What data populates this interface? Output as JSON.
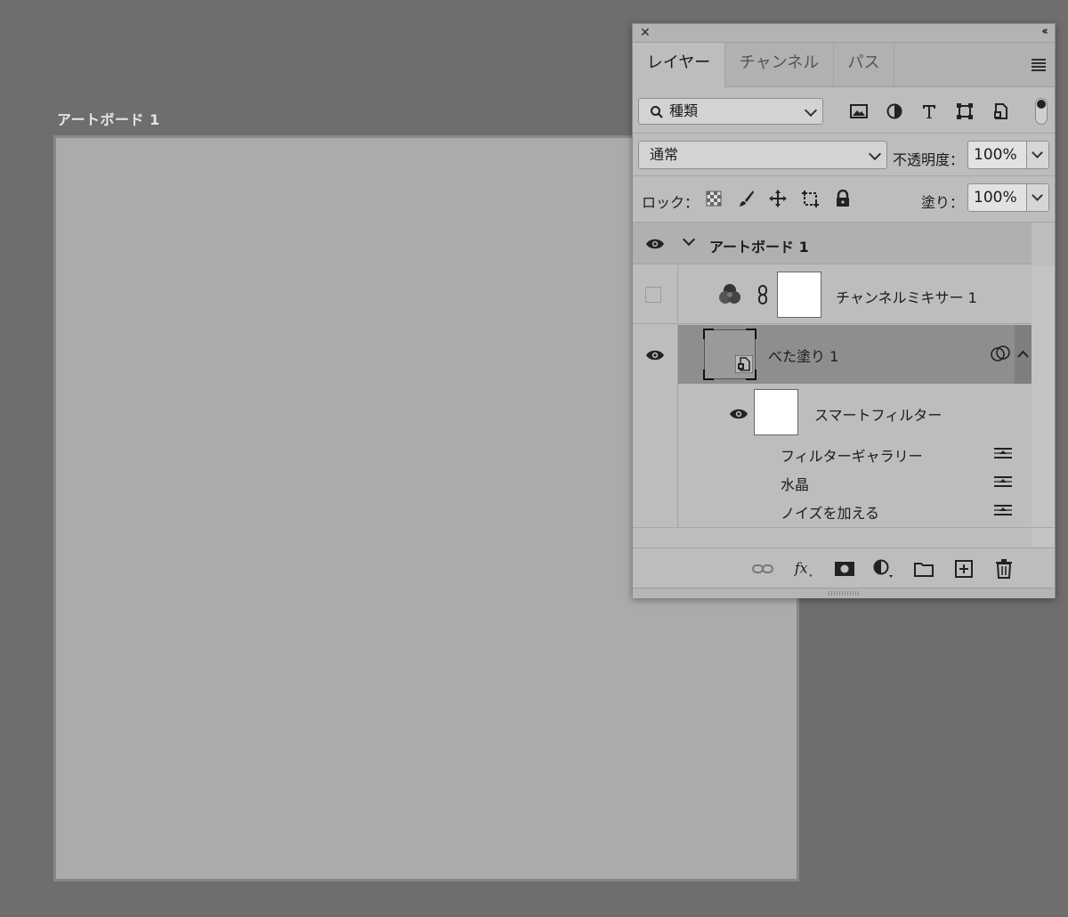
{
  "canvas": {
    "artboard_label": "アートボード 1"
  },
  "panel": {
    "tabs": [
      {
        "label": "レイヤー",
        "active": true
      },
      {
        "label": "チャンネル",
        "active": false
      },
      {
        "label": "パス",
        "active": false
      }
    ],
    "filter": {
      "kind_label": "種類",
      "filter_icons": [
        "image-filter-icon",
        "adjustment-filter-icon",
        "type-filter-icon",
        "shape-filter-icon",
        "smart-object-filter-icon"
      ]
    },
    "blend": {
      "mode": "通常",
      "opacity_label": "不透明度：",
      "opacity_value": "100%"
    },
    "lock": {
      "label": "ロック：",
      "fill_label": "塗り：",
      "fill_value": "100%"
    },
    "layers": {
      "artboard_name": "アートボード 1",
      "mixer_name": "チャンネルミキサー 1",
      "fill_name": "べた塗り 1",
      "smart_filter_name": "スマートフィルター",
      "filters": [
        {
          "name": "フィルターギャラリー"
        },
        {
          "name": "水晶"
        },
        {
          "name": "ノイズを加える"
        }
      ]
    },
    "colors": {
      "selected_row": "#8e8e8e",
      "panel_bg": "#bdbdbd",
      "app_bg": "#6e6e6e"
    }
  }
}
